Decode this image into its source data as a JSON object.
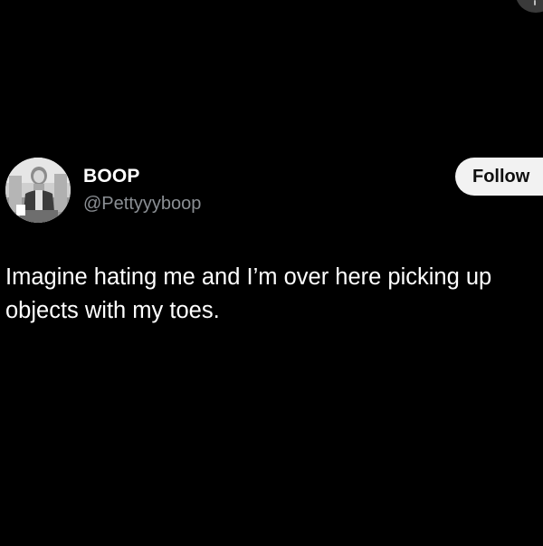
{
  "tweet": {
    "author": {
      "display_name": "BOOP",
      "handle": "@Pettyyyboop",
      "avatar_icon": "profile-photo"
    },
    "follow_label": "Follow",
    "text": "Imagine hating me and I’m over here picking up objects with my toes."
  },
  "colors": {
    "background": "#000000",
    "primary_text": "#ffffff",
    "secondary_text": "#8b8f94",
    "follow_button_bg": "#f2f2f2",
    "follow_button_text": "#0f0f0f"
  }
}
